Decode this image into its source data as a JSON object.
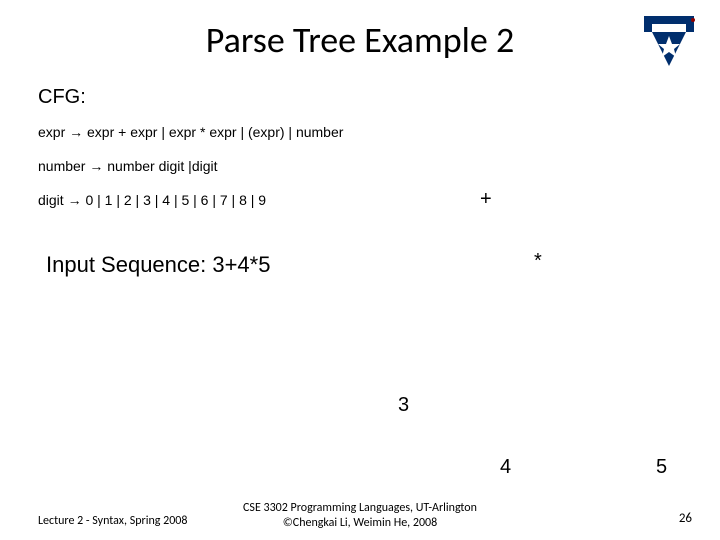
{
  "title": "Parse Tree Example 2",
  "cfg_label": "CFG:",
  "rules": {
    "r1": "expr → expr + expr | expr * expr | (expr) | number",
    "r2": "number → number digit |digit",
    "r3": "digit → 0 | 1 | 2 | 3 | 4 | 5 | 6 | 7 | 8 | 9"
  },
  "input_sequence": "Input Sequence: 3+4*5",
  "tree": {
    "plus": "+",
    "star": "*",
    "n3": "3",
    "n4": "4",
    "n5": "5"
  },
  "footer": {
    "left": "Lecture 2 - Syntax, Spring 2008",
    "center_line1": "CSE 3302 Programming Languages, UT-Arlington",
    "center_line2": "©Chengkai Li, Weimin He, 2008",
    "page": "26"
  }
}
